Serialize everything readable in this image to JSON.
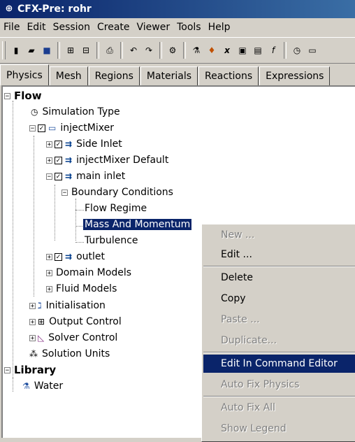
{
  "window": {
    "title": "CFX-Pre:  rohr"
  },
  "menu": [
    "File",
    "Edit",
    "Session",
    "Create",
    "Viewer",
    "Tools",
    "Help"
  ],
  "tabs": [
    "Physics",
    "Mesh",
    "Regions",
    "Materials",
    "Reactions",
    "Expressions"
  ],
  "tree": {
    "flow": "Flow",
    "simulation_type": "Simulation Type",
    "domain": "injectMixer",
    "side_inlet": "Side Inlet",
    "default_bc": "injectMixer Default",
    "main_inlet": "main inlet",
    "boundary_conditions": "Boundary Conditions",
    "flow_regime": "Flow Regime",
    "mass_momentum": "Mass And Momentum",
    "turbulence": "Turbulence",
    "outlet": "outlet",
    "domain_models": "Domain Models",
    "fluid_models": "Fluid Models",
    "initialisation": "Initialisation",
    "output_control": "Output Control",
    "solver_control": "Solver Control",
    "solution_units": "Solution Units",
    "library": "Library",
    "water": "Water"
  },
  "context_menu": {
    "new": "New ...",
    "edit": "Edit ...",
    "delete": "Delete",
    "copy": "Copy",
    "paste": "Paste ...",
    "duplicate": "Duplicate...",
    "edit_cmd": "Edit In Command Editor",
    "auto_fix_physics": "Auto Fix Physics",
    "auto_fix_all": "Auto Fix All",
    "show_legend": "Show Legend"
  },
  "colors": {
    "selection": "#0a246a",
    "face": "#d4d0c8",
    "title_start": "#0a246a",
    "title_end": "#3a6ea5"
  }
}
